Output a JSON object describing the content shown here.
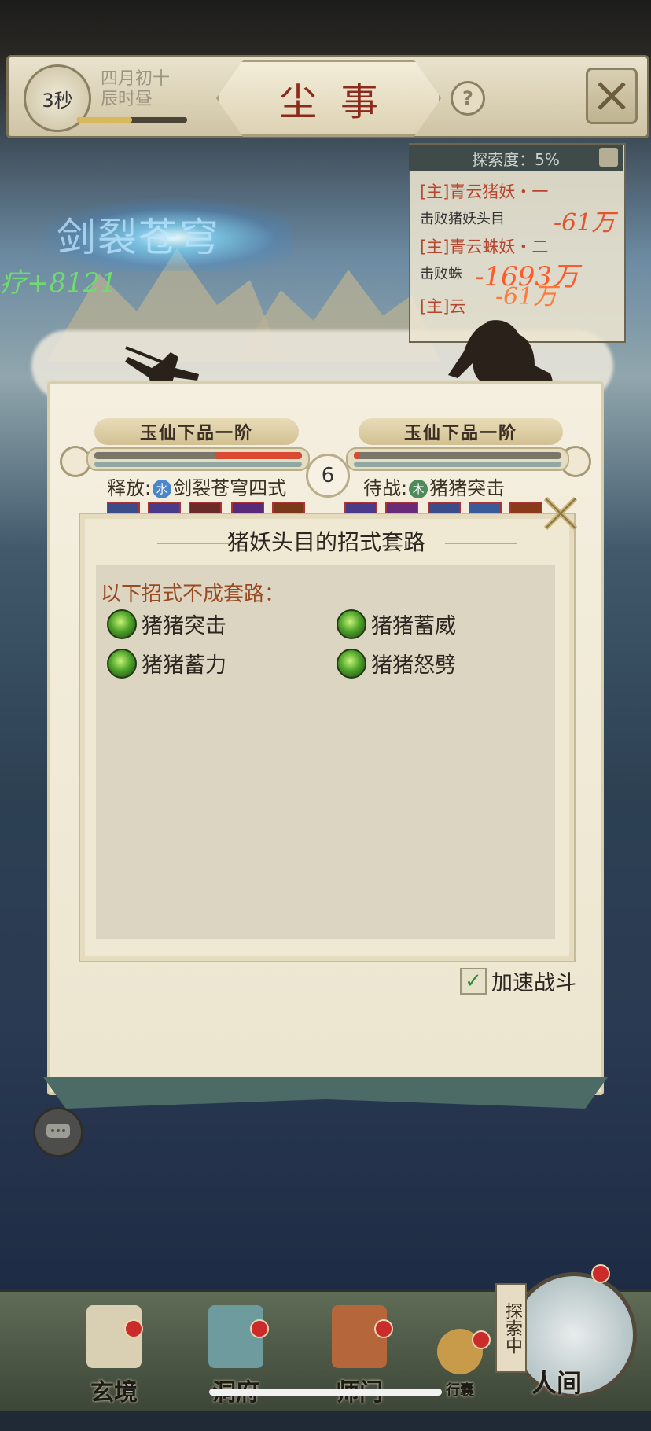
{
  "header": {
    "timer": "3秒",
    "date_line1": "四月初十",
    "date_line2": "辰时昼",
    "time_progress": 0.5,
    "title": "尘事",
    "help_label": "?"
  },
  "quest_panel": {
    "header": "探索度：5%",
    "items": [
      {
        "title": "[主]青云猪妖・一",
        "subtitle": "击败猪妖头目"
      },
      {
        "title": "[主]青云蛛妖・二",
        "subtitle": "击败蛛"
      },
      {
        "title": "[主]云",
        "subtitle": ""
      }
    ]
  },
  "battle_fx": {
    "skill_name": "剑裂苍穹",
    "heal_text": "疗+8121",
    "damage_1": "-61万",
    "damage_2": "-1693万",
    "damage_3": "-61万"
  },
  "battle": {
    "player_rank": "玉仙下品一阶",
    "enemy_rank": "玉仙下品一阶",
    "player_hp": 0.42,
    "enemy_hp": 0.03,
    "round": "6",
    "player_action_prefix": "释放:",
    "player_element": "水",
    "player_skill": "剑裂苍穹四式",
    "enemy_action_prefix": "待战:",
    "enemy_element": "木",
    "enemy_skill": "猪猪突击"
  },
  "dialog": {
    "title": "猪妖头目的招式套路",
    "subheading": "以下招式不成套路：",
    "moves": [
      {
        "name": "猪猪突击",
        "icon": "pig-charge-icon"
      },
      {
        "name": "猪猪蓄威",
        "icon": "pig-intimidate-icon"
      },
      {
        "name": "猪猪蓄力",
        "icon": "pig-charge-power-icon"
      },
      {
        "name": "猪猪怒劈",
        "icon": "pig-rage-slash-icon"
      }
    ],
    "speed_label": "加速战斗",
    "speed_checked": true
  },
  "nav": {
    "items": [
      {
        "label": "玄境"
      },
      {
        "label": "洞府"
      },
      {
        "label": "师门"
      },
      {
        "label": "行囊"
      }
    ],
    "explore_tag": "探索中",
    "world_label": "人间"
  }
}
